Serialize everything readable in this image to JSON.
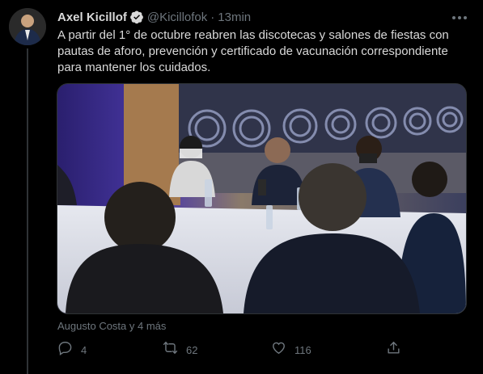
{
  "author": {
    "name": "Axel Kicillof",
    "handle": "@Kicillofok",
    "separator": "·",
    "time": "13min"
  },
  "tweet": {
    "lines": [
      "A partir del 1° de octubre reabren las discotecas y salones de fiestas con",
      "pautas de aforo, prevención y certificado de vacunación correspondiente",
      "para mantener los cuidados."
    ]
  },
  "media": {
    "type": "photo"
  },
  "tagged": "Augusto Costa y 4 más",
  "actions": {
    "reply": "4",
    "retweet": "62",
    "like": "116",
    "share": ""
  },
  "icons": {
    "verified": "verified-badge-icon",
    "more": "more-options-icon",
    "reply": "reply-icon",
    "retweet": "retweet-icon",
    "like": "like-icon",
    "share": "share-icon"
  },
  "colors": {
    "background": "#000000",
    "text": "#d9d9d9",
    "secondary": "#6e767d",
    "divider": "#2f3336"
  }
}
